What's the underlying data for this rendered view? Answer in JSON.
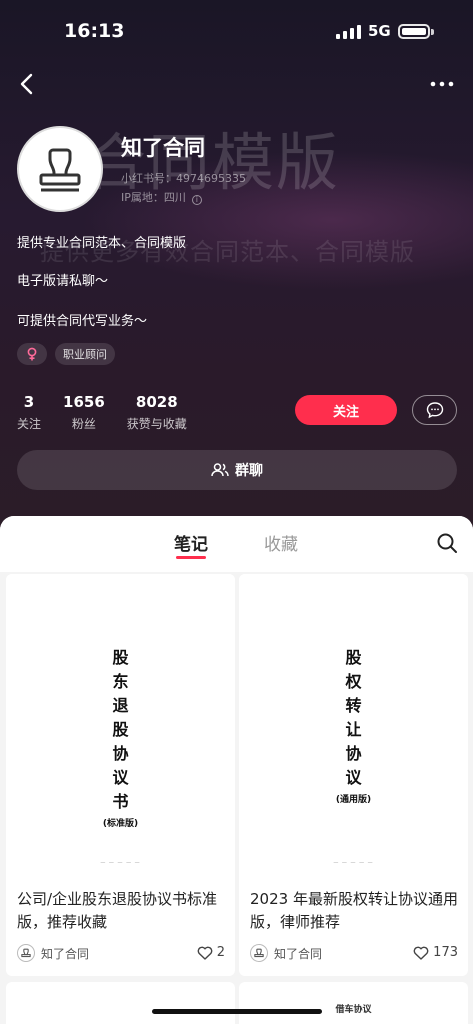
{
  "status_bar": {
    "time": "16:13",
    "network": "5G"
  },
  "profile": {
    "bg_big_text": "合同模版",
    "bg_small_text": "提供更多有效合同范本、合同模版",
    "name": "知了合同",
    "id_line": "小红书号：4974695335",
    "ip_line": "IP属地：四川",
    "bio": [
      "提供专业合同范本、合同模版",
      "电子版请私聊～",
      "可提供合同代写业务～"
    ],
    "tags": {
      "gender_icon": "female-icon",
      "occupation": "职业顾问"
    },
    "stats": [
      {
        "num": "3",
        "label": "关注"
      },
      {
        "num": "1656",
        "label": "粉丝"
      },
      {
        "num": "8028",
        "label": "获赞与收藏"
      }
    ],
    "follow_label": "关注",
    "group_label": "群聊"
  },
  "tabs": {
    "notes": "笔记",
    "collections": "收藏"
  },
  "notes": [
    {
      "cover_chars": [
        "股",
        "东",
        "退",
        "股",
        "协",
        "议",
        "书"
      ],
      "cover_sub": "(标准版)",
      "title": "公司/企业股东退股协议书标准版，推荐收藏",
      "author": "知了合同",
      "likes": "2"
    },
    {
      "cover_chars": [
        "股",
        "权",
        "转",
        "让",
        "协",
        "议"
      ],
      "cover_sub": "(通用版)",
      "title": "2023 年最新股权转让协议通用版，律师推荐",
      "author": "知了合同",
      "likes": "173"
    }
  ],
  "next_row": {
    "right_peek": "借车协议"
  },
  "colors": {
    "accent": "#ff2e4d",
    "hero_bg": "#221a2c"
  }
}
